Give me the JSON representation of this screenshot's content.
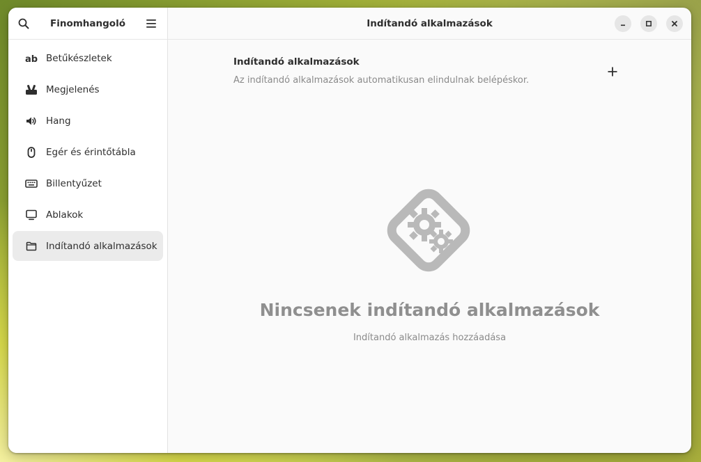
{
  "sidebar": {
    "title": "Finomhangoló",
    "items": [
      {
        "label": "Betűkészletek",
        "icon": "font-icon"
      },
      {
        "label": "Megjelenés",
        "icon": "appearance-icon"
      },
      {
        "label": "Hang",
        "icon": "speaker-icon"
      },
      {
        "label": "Egér és érintőtábla",
        "icon": "mouse-icon"
      },
      {
        "label": "Billentyűzet",
        "icon": "keyboard-icon"
      },
      {
        "label": "Ablakok",
        "icon": "monitor-icon"
      },
      {
        "label": "Indítandó alkalmazások",
        "icon": "folder-icon",
        "active": true
      }
    ]
  },
  "header": {
    "title": "Indítandó alkalmazások"
  },
  "main": {
    "section_title": "Indítandó alkalmazások",
    "section_subtitle": "Az indítandó alkalmazások automatikusan elindulnak belépéskor.",
    "empty_title": "Nincsenek indítandó alkalmazások",
    "empty_subtitle": "Indítandó alkalmazás hozzáadása"
  },
  "colors": {
    "accent_text": "#2e2e2e",
    "muted_text": "#8a8a8a",
    "active_item_bg": "#ebebeb"
  }
}
